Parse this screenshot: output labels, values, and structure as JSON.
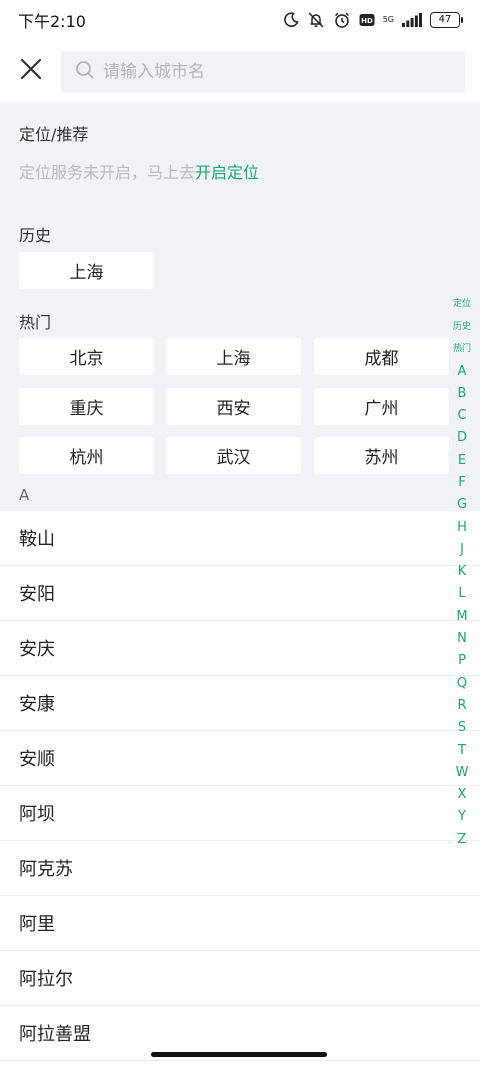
{
  "status_bar": {
    "time": "下午2:10",
    "net_label": "5G",
    "battery": "47",
    "icons": [
      "moon-icon",
      "muted-bell-icon",
      "alarm-icon",
      "hd-icon",
      "signal-icon",
      "battery-icon"
    ]
  },
  "search": {
    "placeholder": "请输入城市名",
    "value": ""
  },
  "locate": {
    "title": "定位/推荐",
    "hint": "定位服务未开启，马上去",
    "link": "开启定位"
  },
  "history": {
    "title": "历史",
    "cities": [
      "上海"
    ]
  },
  "hot": {
    "title": "热门",
    "cities": [
      "北京",
      "上海",
      "成都",
      "重庆",
      "西安",
      "广州",
      "杭州",
      "武汉",
      "苏州"
    ]
  },
  "list": {
    "letter": "A",
    "cities": [
      "鞍山",
      "安阳",
      "安庆",
      "安康",
      "安顺",
      "阿坝",
      "阿克苏",
      "阿里",
      "阿拉尔",
      "阿拉善盟"
    ]
  },
  "index_bar": {
    "words": [
      "定位",
      "历史",
      "热门"
    ],
    "letters": [
      "A",
      "B",
      "C",
      "D",
      "E",
      "F",
      "G",
      "H",
      "J",
      "K",
      "L",
      "M",
      "N",
      "P",
      "Q",
      "R",
      "S",
      "T",
      "W",
      "X",
      "Y",
      "Z"
    ]
  },
  "colors": {
    "accent": "#17a86a",
    "panel_bg": "#f1f3f9",
    "chip_bg": "#ffffff"
  }
}
